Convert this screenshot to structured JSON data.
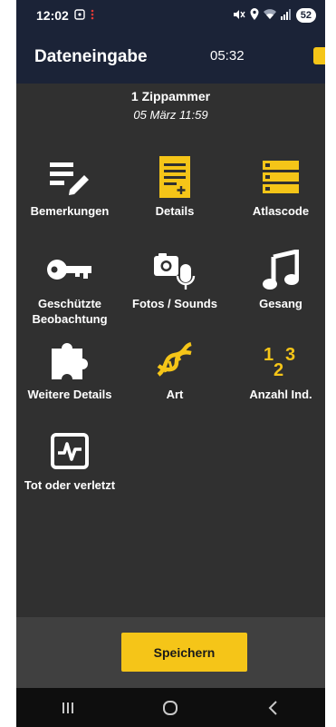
{
  "status": {
    "time": "12:02",
    "battery": "52"
  },
  "appbar": {
    "title": "Dateneingabe",
    "timer": "05:32"
  },
  "info": {
    "species": "1 Zippammer",
    "date": "05 März 11:59"
  },
  "tiles": [
    {
      "label": "Bemerkungen",
      "icon": "notes-edit-icon"
    },
    {
      "label": "Details",
      "icon": "document-add-icon"
    },
    {
      "label": "Atlascode",
      "icon": "list-icon"
    },
    {
      "label": "Geschützte Beobachtung",
      "icon": "key-icon"
    },
    {
      "label": "Fotos / Sounds",
      "icon": "camera-microphone-icon"
    },
    {
      "label": "Gesang",
      "icon": "music-note-icon"
    },
    {
      "label": "Weitere Details",
      "icon": "puzzle-icon"
    },
    {
      "label": "Art",
      "icon": "dna-icon"
    },
    {
      "label": "Anzahl Ind.",
      "icon": "numbers-icon"
    },
    {
      "label": "Tot oder verletzt",
      "icon": "pulse-icon"
    }
  ],
  "footer": {
    "save_label": "Speichern"
  },
  "colors": {
    "accent": "#f5c518",
    "header": "#1b2337",
    "background": "#303030"
  }
}
